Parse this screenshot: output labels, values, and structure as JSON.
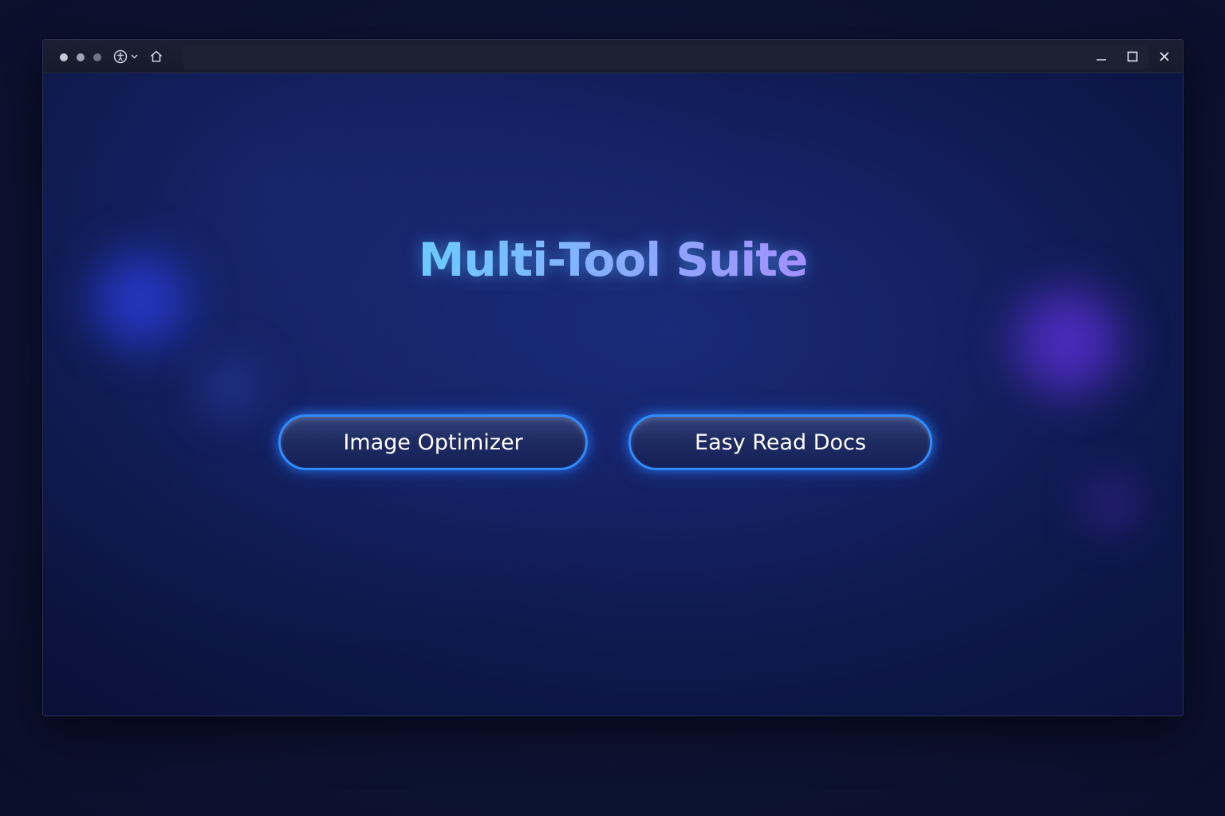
{
  "app": {
    "title": "Multi-Tool Suite"
  },
  "actions": [
    {
      "label": "Image Optimizer"
    },
    {
      "label": "Easy Read Docs"
    }
  ],
  "window_controls": {
    "minimize_icon": "minimize-icon",
    "maximize_icon": "maximize-icon",
    "close_icon": "close-icon"
  },
  "toolbar_icons": {
    "accessibility": "accessibility-icon",
    "dropdown": "chevron-down-icon",
    "home": "home-icon"
  },
  "colors": {
    "accent_glow": "#2f8cff",
    "title_gradient_start": "#49e6ff",
    "title_gradient_end": "#c9a2ff",
    "background": "#0c1232"
  }
}
